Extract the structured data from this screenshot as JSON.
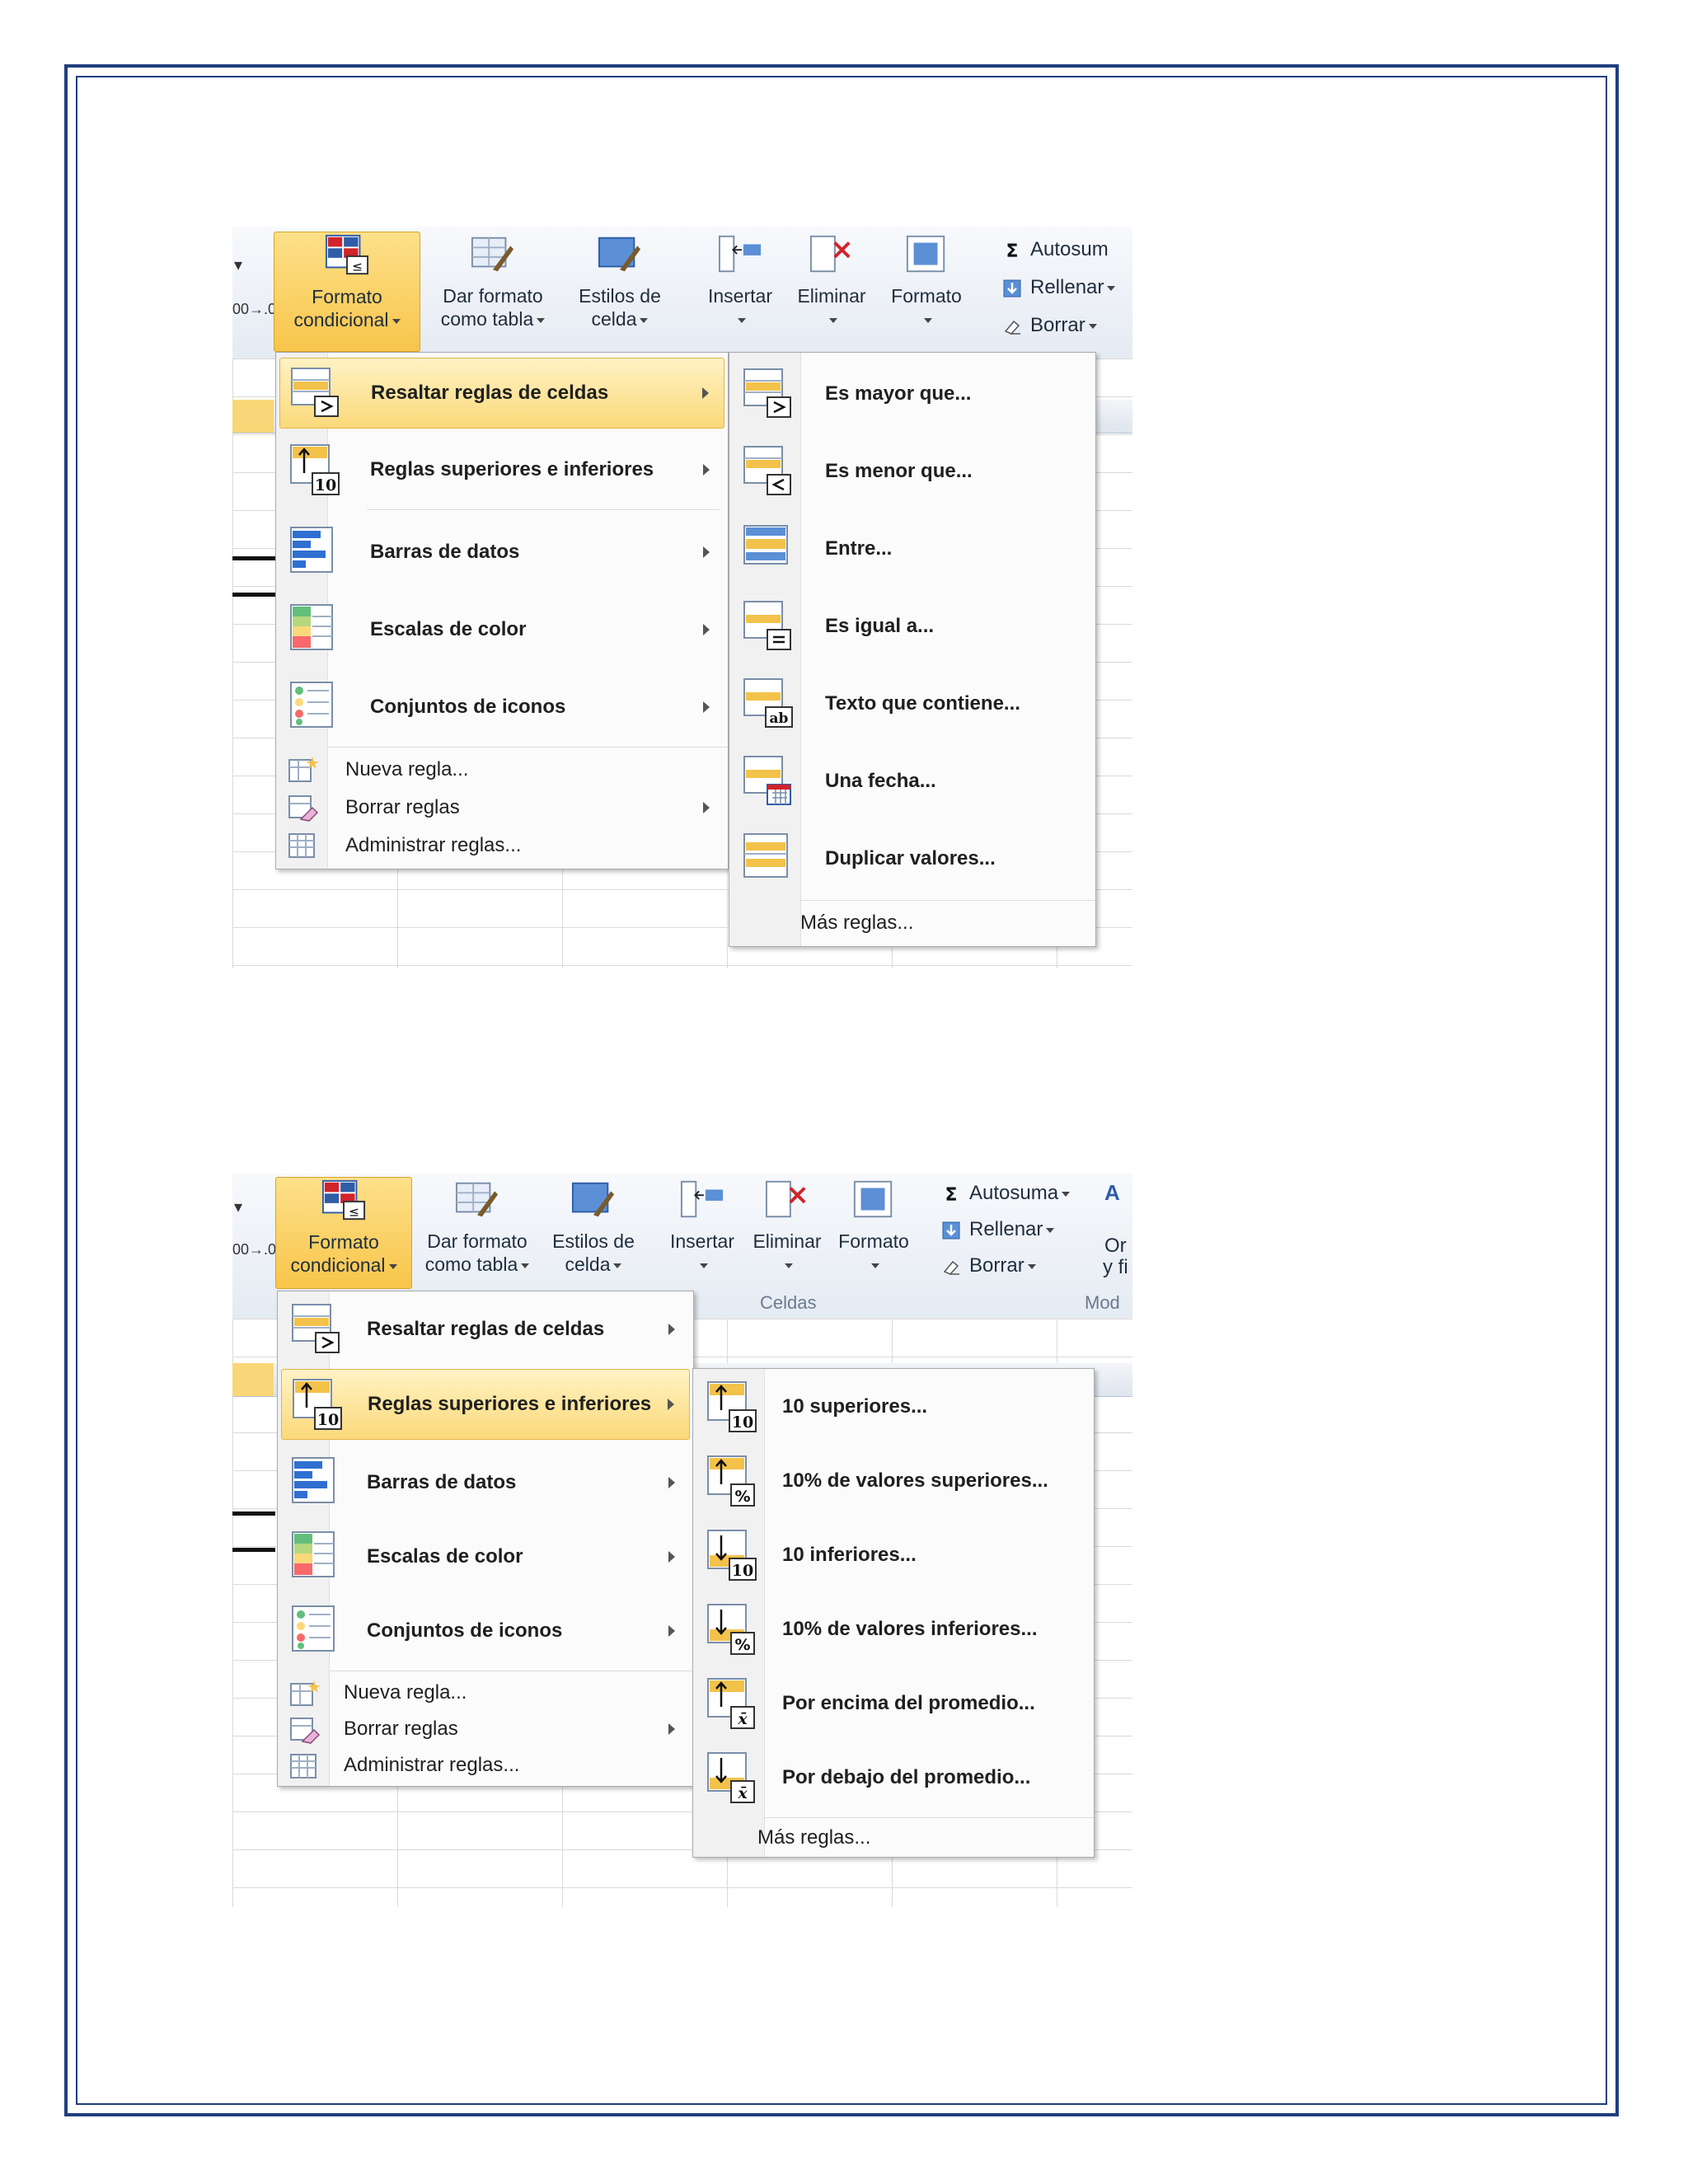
{
  "ribbon": {
    "formato": [
      "Formato",
      "condicional"
    ],
    "dar_formato": [
      "Dar formato",
      "como tabla"
    ],
    "estilos": [
      "Estilos de",
      "celda"
    ],
    "insertar": "Insertar",
    "eliminar": "Eliminar",
    "formato_btn": "Formato",
    "autosum_cut": "Autosum",
    "autosuma": "Autosuma",
    "rellenar": "Rellenar",
    "borrar": "Borrar",
    "celdas": "Celdas",
    "mod": "Mod",
    "ordenar_cut": [
      "Or",
      "y fi"
    ],
    "number_fmt": "00→.0"
  },
  "main_menu": {
    "resaltar": "Resaltar reglas de celdas",
    "superiores": "Reglas superiores e inferiores",
    "barras": "Barras de datos",
    "escalas": "Escalas de color",
    "conjuntos": "Conjuntos de iconos",
    "nueva": "Nueva regla...",
    "borrar": "Borrar reglas",
    "administrar": "Administrar reglas..."
  },
  "submenu_resaltar": {
    "items": [
      "Es mayor que...",
      "Es menor que...",
      "Entre...",
      "Es igual a...",
      "Texto que contiene...",
      "Una fecha...",
      "Duplicar valores..."
    ],
    "mas": "Más reglas..."
  },
  "submenu_superiores": {
    "items": [
      "10 superiores...",
      "10% de valores superiores...",
      "10 inferiores...",
      "10% de valores inferiores...",
      "Por encima del promedio...",
      "Por debajo del promedio..."
    ],
    "mas": "Más reglas..."
  },
  "colors": {
    "frame": "#1f3f7f",
    "highlight": "#fbd97a",
    "menu_bg": "#fbfbfb"
  }
}
